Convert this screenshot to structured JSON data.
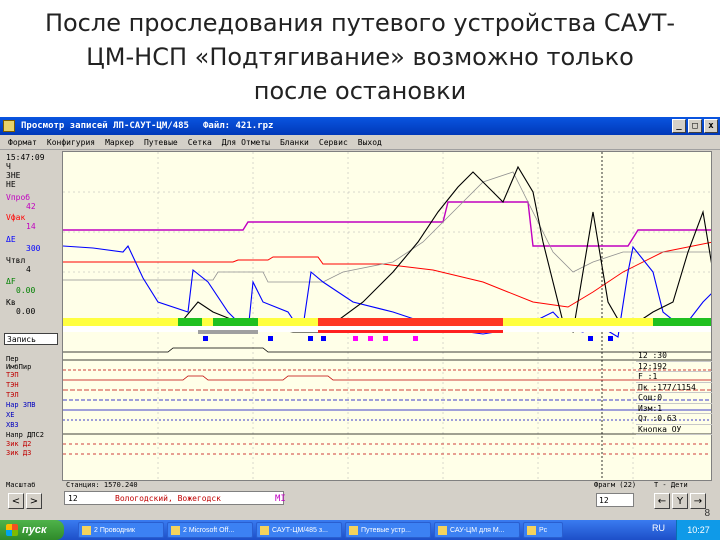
{
  "slide": {
    "title_lines": [
      "После проследования путевого устройства САУТ-",
      "ЦМ-НСП «Подтягивание» возможно только",
      "после остановки"
    ]
  },
  "window": {
    "title": "Просмотр записей ЛП-САУТ-ЦМ/485",
    "file": "Файл: 421.rpz",
    "buttons": {
      "minimize": "_",
      "maximize": "□",
      "close": "x"
    }
  },
  "menu": [
    "Формат",
    "Конфигурия",
    "Маркер",
    "Путевые",
    "Сетка",
    "Для Отметы",
    "Бланки",
    "Сервис",
    "Выход"
  ],
  "left_panel": {
    "time": "15:47:09",
    "lines": [
      "Ч",
      "ЗНЕ",
      "НЕ"
    ],
    "vproj_label": "Vпроб",
    "vproj_value": "42",
    "vfact_label": "Vфак",
    "vfact_value": "14",
    "de_label": "ΔE",
    "de_value": "300",
    "brake_label": "Чтвл",
    "brake_value": "4",
    "df_label": "ΔF",
    "df_value": "0.00",
    "kv_label": "Кв",
    "kv_value": "0.00",
    "record_label": "Запись"
  },
  "channels": [
    "Пер",
    "ИмбПир",
    "ТЭП",
    "ТЭН",
    "ТЭЛ",
    "Нар ЗПВ",
    "ХЕ",
    "ХВЗ",
    "Напр ДПС2",
    "Зик Д2",
    "Зик Д3"
  ],
  "info_panel": [
    "12 :30",
    "12:192",
    "F :1",
    "Пк :177/1154",
    "Сош:0",
    "Изм:1",
    "Qт :0.63",
    "Кнопка ОУ"
  ],
  "bottom": {
    "masshtab_label": "Масштаб",
    "left_btn": "<",
    "right_btn": ">",
    "station_label": "Станция: 1570.240",
    "station_num": "12",
    "station_name": "Вологодский, Вожегодск",
    "station_mi": "MI",
    "frame_label": "Фрагм (22)",
    "frame_value": "12",
    "step_label": "Т - Дети",
    "step_prev": "←",
    "step_mid": "Y",
    "step_next": "→"
  },
  "taskbar": {
    "start": "пуск",
    "tasks": [
      "2 Проводник",
      "2 Microsoft Off...",
      "САУТ-ЦМ/485 з...",
      "Путевые устр...",
      "САУ-ЦМ для М...",
      "Рс"
    ],
    "lang": "RU",
    "clock": "10:27"
  },
  "page_number": "8",
  "colors": {
    "speed_fact": "#0000ff",
    "speed_limit": "#c000c0",
    "target": "#ff0000",
    "brake": "#000000",
    "gradient": "#a0a0a0"
  }
}
